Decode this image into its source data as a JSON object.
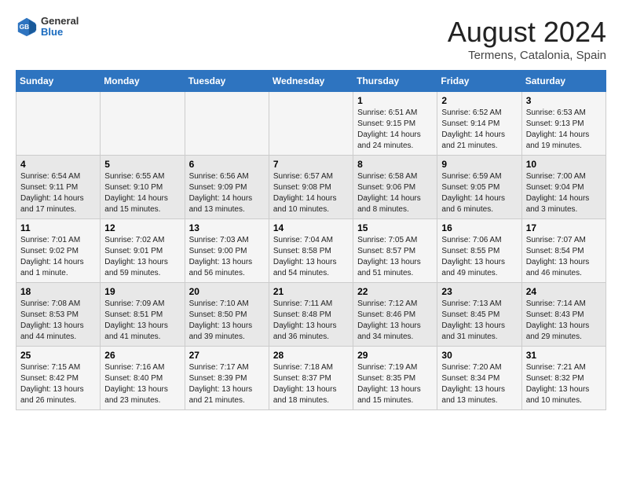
{
  "logo": {
    "general": "General",
    "blue": "Blue"
  },
  "title": "August 2024",
  "subtitle": "Termens, Catalonia, Spain",
  "days_header": [
    "Sunday",
    "Monday",
    "Tuesday",
    "Wednesday",
    "Thursday",
    "Friday",
    "Saturday"
  ],
  "weeks": [
    [
      {
        "day": "",
        "sunrise": "",
        "sunset": "",
        "daylight": ""
      },
      {
        "day": "",
        "sunrise": "",
        "sunset": "",
        "daylight": ""
      },
      {
        "day": "",
        "sunrise": "",
        "sunset": "",
        "daylight": ""
      },
      {
        "day": "",
        "sunrise": "",
        "sunset": "",
        "daylight": ""
      },
      {
        "day": "1",
        "sunrise": "Sunrise: 6:51 AM",
        "sunset": "Sunset: 9:15 PM",
        "daylight": "Daylight: 14 hours and 24 minutes."
      },
      {
        "day": "2",
        "sunrise": "Sunrise: 6:52 AM",
        "sunset": "Sunset: 9:14 PM",
        "daylight": "Daylight: 14 hours and 21 minutes."
      },
      {
        "day": "3",
        "sunrise": "Sunrise: 6:53 AM",
        "sunset": "Sunset: 9:13 PM",
        "daylight": "Daylight: 14 hours and 19 minutes."
      }
    ],
    [
      {
        "day": "4",
        "sunrise": "Sunrise: 6:54 AM",
        "sunset": "Sunset: 9:11 PM",
        "daylight": "Daylight: 14 hours and 17 minutes."
      },
      {
        "day": "5",
        "sunrise": "Sunrise: 6:55 AM",
        "sunset": "Sunset: 9:10 PM",
        "daylight": "Daylight: 14 hours and 15 minutes."
      },
      {
        "day": "6",
        "sunrise": "Sunrise: 6:56 AM",
        "sunset": "Sunset: 9:09 PM",
        "daylight": "Daylight: 14 hours and 13 minutes."
      },
      {
        "day": "7",
        "sunrise": "Sunrise: 6:57 AM",
        "sunset": "Sunset: 9:08 PM",
        "daylight": "Daylight: 14 hours and 10 minutes."
      },
      {
        "day": "8",
        "sunrise": "Sunrise: 6:58 AM",
        "sunset": "Sunset: 9:06 PM",
        "daylight": "Daylight: 14 hours and 8 minutes."
      },
      {
        "day": "9",
        "sunrise": "Sunrise: 6:59 AM",
        "sunset": "Sunset: 9:05 PM",
        "daylight": "Daylight: 14 hours and 6 minutes."
      },
      {
        "day": "10",
        "sunrise": "Sunrise: 7:00 AM",
        "sunset": "Sunset: 9:04 PM",
        "daylight": "Daylight: 14 hours and 3 minutes."
      }
    ],
    [
      {
        "day": "11",
        "sunrise": "Sunrise: 7:01 AM",
        "sunset": "Sunset: 9:02 PM",
        "daylight": "Daylight: 14 hours and 1 minute."
      },
      {
        "day": "12",
        "sunrise": "Sunrise: 7:02 AM",
        "sunset": "Sunset: 9:01 PM",
        "daylight": "Daylight: 13 hours and 59 minutes."
      },
      {
        "day": "13",
        "sunrise": "Sunrise: 7:03 AM",
        "sunset": "Sunset: 9:00 PM",
        "daylight": "Daylight: 13 hours and 56 minutes."
      },
      {
        "day": "14",
        "sunrise": "Sunrise: 7:04 AM",
        "sunset": "Sunset: 8:58 PM",
        "daylight": "Daylight: 13 hours and 54 minutes."
      },
      {
        "day": "15",
        "sunrise": "Sunrise: 7:05 AM",
        "sunset": "Sunset: 8:57 PM",
        "daylight": "Daylight: 13 hours and 51 minutes."
      },
      {
        "day": "16",
        "sunrise": "Sunrise: 7:06 AM",
        "sunset": "Sunset: 8:55 PM",
        "daylight": "Daylight: 13 hours and 49 minutes."
      },
      {
        "day": "17",
        "sunrise": "Sunrise: 7:07 AM",
        "sunset": "Sunset: 8:54 PM",
        "daylight": "Daylight: 13 hours and 46 minutes."
      }
    ],
    [
      {
        "day": "18",
        "sunrise": "Sunrise: 7:08 AM",
        "sunset": "Sunset: 8:53 PM",
        "daylight": "Daylight: 13 hours and 44 minutes."
      },
      {
        "day": "19",
        "sunrise": "Sunrise: 7:09 AM",
        "sunset": "Sunset: 8:51 PM",
        "daylight": "Daylight: 13 hours and 41 minutes."
      },
      {
        "day": "20",
        "sunrise": "Sunrise: 7:10 AM",
        "sunset": "Sunset: 8:50 PM",
        "daylight": "Daylight: 13 hours and 39 minutes."
      },
      {
        "day": "21",
        "sunrise": "Sunrise: 7:11 AM",
        "sunset": "Sunset: 8:48 PM",
        "daylight": "Daylight: 13 hours and 36 minutes."
      },
      {
        "day": "22",
        "sunrise": "Sunrise: 7:12 AM",
        "sunset": "Sunset: 8:46 PM",
        "daylight": "Daylight: 13 hours and 34 minutes."
      },
      {
        "day": "23",
        "sunrise": "Sunrise: 7:13 AM",
        "sunset": "Sunset: 8:45 PM",
        "daylight": "Daylight: 13 hours and 31 minutes."
      },
      {
        "day": "24",
        "sunrise": "Sunrise: 7:14 AM",
        "sunset": "Sunset: 8:43 PM",
        "daylight": "Daylight: 13 hours and 29 minutes."
      }
    ],
    [
      {
        "day": "25",
        "sunrise": "Sunrise: 7:15 AM",
        "sunset": "Sunset: 8:42 PM",
        "daylight": "Daylight: 13 hours and 26 minutes."
      },
      {
        "day": "26",
        "sunrise": "Sunrise: 7:16 AM",
        "sunset": "Sunset: 8:40 PM",
        "daylight": "Daylight: 13 hours and 23 minutes."
      },
      {
        "day": "27",
        "sunrise": "Sunrise: 7:17 AM",
        "sunset": "Sunset: 8:39 PM",
        "daylight": "Daylight: 13 hours and 21 minutes."
      },
      {
        "day": "28",
        "sunrise": "Sunrise: 7:18 AM",
        "sunset": "Sunset: 8:37 PM",
        "daylight": "Daylight: 13 hours and 18 minutes."
      },
      {
        "day": "29",
        "sunrise": "Sunrise: 7:19 AM",
        "sunset": "Sunset: 8:35 PM",
        "daylight": "Daylight: 13 hours and 15 minutes."
      },
      {
        "day": "30",
        "sunrise": "Sunrise: 7:20 AM",
        "sunset": "Sunset: 8:34 PM",
        "daylight": "Daylight: 13 hours and 13 minutes."
      },
      {
        "day": "31",
        "sunrise": "Sunrise: 7:21 AM",
        "sunset": "Sunset: 8:32 PM",
        "daylight": "Daylight: 13 hours and 10 minutes."
      }
    ]
  ]
}
